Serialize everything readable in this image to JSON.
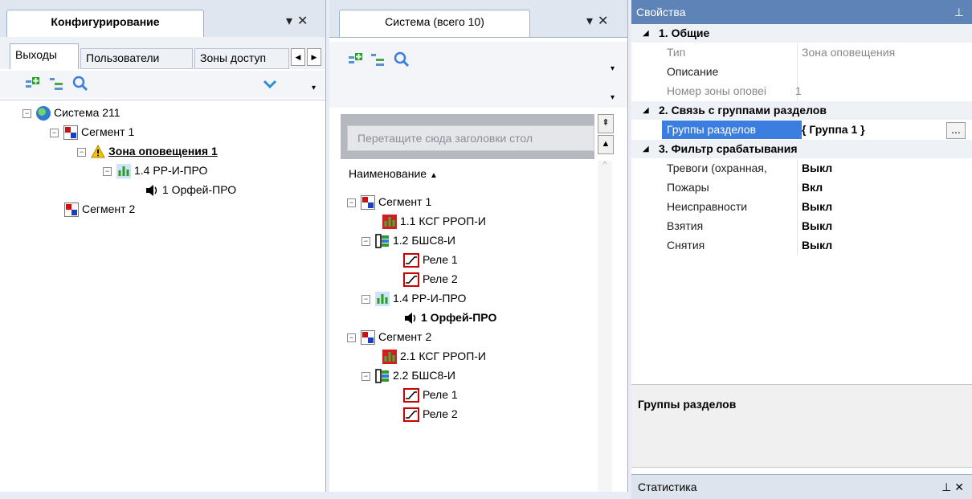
{
  "left_panel": {
    "title": "Конфигурирование",
    "subtabs": [
      "Выходы",
      "Пользователи",
      "Зоны доступ"
    ],
    "tree": [
      {
        "label": "Система 211"
      },
      {
        "label": "Сегмент 1"
      },
      {
        "label": "Зона оповещения 1"
      },
      {
        "label": "1.4 РР-И-ПРО"
      },
      {
        "label": "1 Орфей-ПРО"
      },
      {
        "label": "Сегмент 2"
      }
    ]
  },
  "middle_panel": {
    "title": "Система (всего 10)",
    "group_hint": "Перетащите сюда заголовки стол",
    "column_header": "Наименование",
    "rows": [
      {
        "label": "Сегмент 1"
      },
      {
        "label": "1.1 КСГ РРОП-И"
      },
      {
        "label": "1.2 БШС8-И"
      },
      {
        "label": "Реле 1"
      },
      {
        "label": "Реле 2"
      },
      {
        "label": "1.4 РР-И-ПРО"
      },
      {
        "label": "1 Орфей-ПРО"
      },
      {
        "label": "Сегмент 2"
      },
      {
        "label": "2.1 КСГ РРОП-И"
      },
      {
        "label": "2.2 БШС8-И"
      },
      {
        "label": "Реле 1"
      },
      {
        "label": "Реле 2"
      }
    ]
  },
  "properties": {
    "title": "Свойства",
    "categories": [
      {
        "name": "1. Общие"
      },
      {
        "name": "2. Связь с группами разделов"
      },
      {
        "name": "3. Фильтр срабатывания"
      }
    ],
    "general": [
      {
        "name": "Тип",
        "value": "Зона оповещения"
      },
      {
        "name": "Описание",
        "value": ""
      },
      {
        "name": "Номер зоны оповеі",
        "value": "1"
      }
    ],
    "groups_row": {
      "name": "Группы разделов",
      "value": "{ Группа 1 }",
      "button": "..."
    },
    "filter": [
      {
        "name": "Тревоги (охранная,",
        "value": "Выкл"
      },
      {
        "name": "Пожары",
        "value": "Вкл"
      },
      {
        "name": "Неисправности",
        "value": "Выкл"
      },
      {
        "name": "Взятия",
        "value": "Выкл"
      },
      {
        "name": "Снятия",
        "value": "Выкл"
      }
    ],
    "description_title": "Группы разделов",
    "stats_title": "Статистика"
  },
  "colors": {
    "accent_blue": "#2b6fd6",
    "panel_header": "#5e84b7",
    "selection": "#3b7ee0"
  }
}
